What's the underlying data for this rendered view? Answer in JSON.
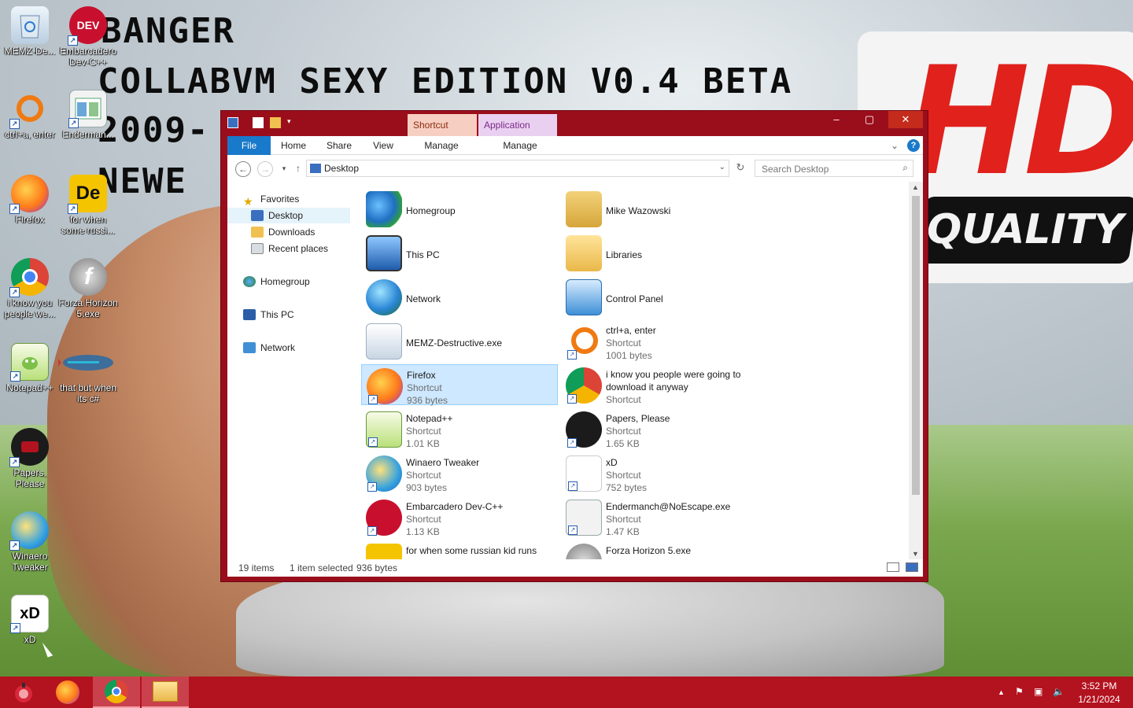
{
  "wallpaper": {
    "line1": "BANGER",
    "line2": "COLLABVM SEXY EDITION V0.4 BETA",
    "line3": "2009-",
    "line4": "NEWE",
    "badge_hd": "HD",
    "badge_quality": "QUALITY"
  },
  "desktop_icons": [
    {
      "label": "MEMZ-De...",
      "icon": "recycle-bin-icon"
    },
    {
      "label": "Embarcadero Dev-C++",
      "icon": "devcpp-icon"
    },
    {
      "label": "ctrl+a, enter",
      "icon": "orange-ring-icon"
    },
    {
      "label": "Enderman...",
      "icon": "window-app-icon"
    },
    {
      "label": "Firefox",
      "icon": "firefox-icon"
    },
    {
      "label": "for when some russi...",
      "icon": "de-app-icon"
    },
    {
      "label": "i know you people we...",
      "icon": "chrome-icon"
    },
    {
      "label": "Forza Horizon 5.exe",
      "icon": "flash-icon"
    },
    {
      "label": "Notepad++",
      "icon": "notepadpp-icon"
    },
    {
      "label": "that but when its c#",
      "icon": "fish-icon"
    },
    {
      "label": "Papers, Please",
      "icon": "papers-please-icon"
    },
    {
      "label": "Winaero Tweaker",
      "icon": "winaero-icon"
    },
    {
      "label": "xD",
      "icon": "xd-icon"
    }
  ],
  "explorer": {
    "title": "Desktop",
    "context_tabs": {
      "shortcut_tools": "Shortcut Tools",
      "application_tools": "Application Tools"
    },
    "ribbon_tabs": {
      "file": "File",
      "home": "Home",
      "share": "Share",
      "view": "View",
      "manage1": "Manage",
      "manage2": "Manage"
    },
    "address": "Desktop",
    "search_placeholder": "Search Desktop",
    "nav": {
      "favorites": "Favorites",
      "desktop": "Desktop",
      "downloads": "Downloads",
      "recent": "Recent places",
      "homegroup": "Homegroup",
      "thispc": "This PC",
      "network": "Network"
    },
    "items": [
      {
        "name": "Homegroup",
        "type": "",
        "size": ""
      },
      {
        "name": "Mike Wazowski",
        "type": "",
        "size": ""
      },
      {
        "name": "This PC",
        "type": "",
        "size": ""
      },
      {
        "name": "Libraries",
        "type": "",
        "size": ""
      },
      {
        "name": "Network",
        "type": "",
        "size": ""
      },
      {
        "name": "Control Panel",
        "type": "",
        "size": ""
      },
      {
        "name": "MEMZ-Destructive.exe",
        "type": "",
        "size": ""
      },
      {
        "name": "ctrl+a, enter",
        "type": "Shortcut",
        "size": "1001 bytes"
      },
      {
        "name": "Firefox",
        "type": "Shortcut",
        "size": "936 bytes"
      },
      {
        "name": "i know you people were going to",
        "name2": "download it anyway",
        "type": "Shortcut",
        "size": ""
      },
      {
        "name": "Notepad++",
        "type": "Shortcut",
        "size": "1.01 KB"
      },
      {
        "name": "Papers, Please",
        "type": "Shortcut",
        "size": "1.65 KB"
      },
      {
        "name": "Winaero Tweaker",
        "type": "Shortcut",
        "size": "903 bytes"
      },
      {
        "name": "xD",
        "type": "Shortcut",
        "size": "752 bytes"
      },
      {
        "name": "Embarcadero Dev-C++",
        "type": "Shortcut",
        "size": "1.13 KB"
      },
      {
        "name": "Endermanch@NoEscape.exe",
        "type": "Shortcut",
        "size": "1.47 KB"
      },
      {
        "name": "for when some russian kid runs",
        "type": "",
        "size": ""
      },
      {
        "name": "Forza Horizon 5.exe",
        "type": "",
        "size": ""
      }
    ],
    "status": {
      "count": "19 items",
      "selected": "1 item selected",
      "size": "936 bytes"
    }
  },
  "taskbar": {
    "clock_time": "3:52 PM",
    "clock_date": "1/21/2024"
  },
  "colors": {
    "window_frame": "#9a0e1c",
    "taskbar": "#b3121f",
    "file_tab": "#1979ca",
    "selection": "#cde8ff"
  }
}
